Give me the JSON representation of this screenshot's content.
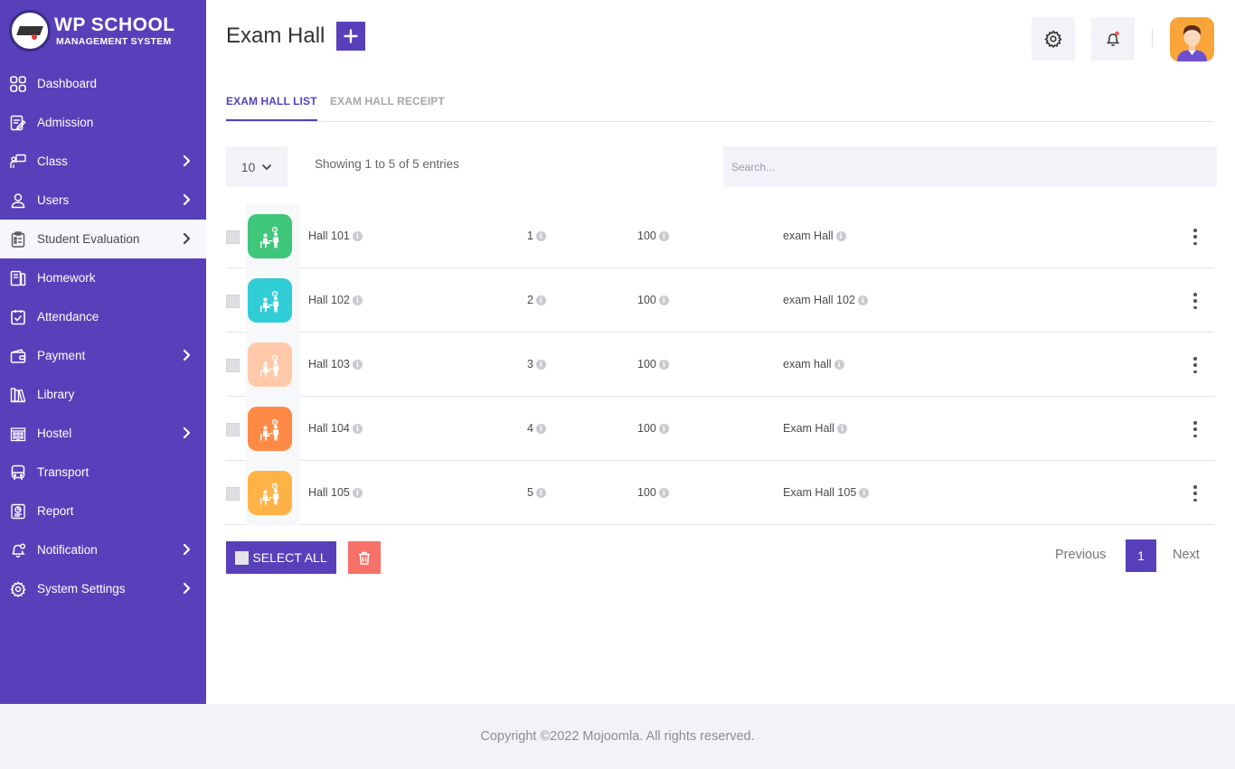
{
  "brand": {
    "title": "WP SCHOOL",
    "subtitle": "MANAGEMENT SYSTEM"
  },
  "sidebar": {
    "items": [
      {
        "label": "Dashboard",
        "icon": "dashboard-grid-icon"
      },
      {
        "label": "Admission",
        "icon": "admission-form-icon"
      },
      {
        "label": "Class",
        "icon": "class-teacher-icon",
        "has_submenu": true
      },
      {
        "label": "Users",
        "icon": "user-icon",
        "has_submenu": true
      },
      {
        "label": "Student Evaluation",
        "icon": "evaluation-clipboard-icon",
        "has_submenu": true,
        "active": true
      },
      {
        "label": "Homework",
        "icon": "homework-icon"
      },
      {
        "label": "Attendance",
        "icon": "attendance-check-icon"
      },
      {
        "label": "Payment",
        "icon": "wallet-icon",
        "has_submenu": true
      },
      {
        "label": "Library",
        "icon": "library-books-icon"
      },
      {
        "label": "Hostel",
        "icon": "hostel-building-icon",
        "has_submenu": true
      },
      {
        "label": "Transport",
        "icon": "bus-icon"
      },
      {
        "label": "Report",
        "icon": "report-icon"
      },
      {
        "label": "Notification",
        "icon": "bell-icon",
        "has_submenu": true
      },
      {
        "label": "System Settings",
        "icon": "gear-icon",
        "has_submenu": true
      }
    ]
  },
  "header": {
    "title": "Exam Hall"
  },
  "tabs": [
    {
      "label": "EXAM HALL LIST",
      "active": true
    },
    {
      "label": "EXAM HALL RECEIPT",
      "active": false
    }
  ],
  "table_controls": {
    "page_length": "10",
    "info": "Showing 1 to 5 of 5 entries",
    "search_placeholder": "Search..."
  },
  "rows": [
    {
      "name": "Hall 101",
      "number": "1",
      "capacity": "100",
      "description": "exam Hall",
      "color": "#3ec67a"
    },
    {
      "name": "Hall 102",
      "number": "2",
      "capacity": "100",
      "description": "exam Hall 102",
      "color": "#30cdd6"
    },
    {
      "name": "Hall 103",
      "number": "3",
      "capacity": "100",
      "description": "exam hall",
      "color": "#ffc9a9"
    },
    {
      "name": "Hall 104",
      "number": "4",
      "capacity": "100",
      "description": "Exam Hall",
      "color": "#ff8a46"
    },
    {
      "name": "Hall 105",
      "number": "5",
      "capacity": "100",
      "description": "Exam Hall 105",
      "color": "#ffb347"
    }
  ],
  "actions": {
    "select_all": "SELECT ALL"
  },
  "pagination": {
    "previous": "Previous",
    "current": "1",
    "next": "Next"
  },
  "footer": {
    "text": "Copyright ©2022 Mojoomla. All rights reserved."
  },
  "colors": {
    "primary": "#5840bb",
    "delete": "#f77168",
    "panel": "#f1f3f8"
  }
}
